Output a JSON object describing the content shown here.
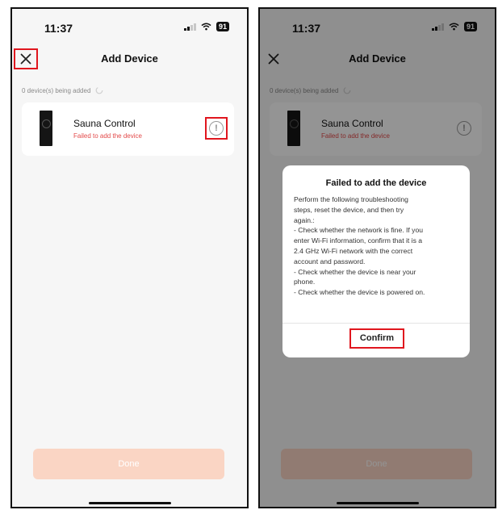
{
  "status_bar": {
    "time": "11:37",
    "battery": "91"
  },
  "header": {
    "title": "Add Device"
  },
  "progress": {
    "text": "0 device(s) being added"
  },
  "device": {
    "name": "Sauna Control",
    "status": "Failed to add the device"
  },
  "done_button": {
    "label": "Done"
  },
  "dialog": {
    "title": "Failed to add the device",
    "lines": [
      "Perform the following troubleshooting",
      "steps, reset the device, and then try",
      "again.:",
      "- Check whether the network is fine. If you",
      "enter Wi-Fi information, confirm that it is a",
      "2.4 GHz Wi-Fi network with the correct",
      "account and password.",
      "- Check whether the device is near your",
      "phone.",
      "- Check whether the device is powered on."
    ],
    "confirm_label": "Confirm"
  },
  "colors": {
    "highlight": "#e0161e",
    "error_text": "#e34a4a",
    "done_button_bg": "#fad5c4",
    "screen_bg": "#f6f6f6"
  },
  "icons": {
    "close": "close-icon",
    "info": "info-icon",
    "spinner": "spinner-icon",
    "signal": "signal-icon",
    "wifi": "wifi-icon",
    "battery": "battery-icon"
  }
}
